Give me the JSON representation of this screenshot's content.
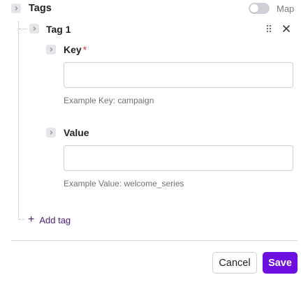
{
  "tags_section": {
    "title": "Tags",
    "toggle_label": "Map",
    "toggle_on": false
  },
  "tag_item": {
    "title": "Tag 1"
  },
  "key_field": {
    "label": "Key",
    "required_mark": "*",
    "value": "",
    "placeholder": "",
    "helper": "Example Key: campaign"
  },
  "value_field": {
    "label": "Value",
    "value": "",
    "placeholder": "",
    "helper": "Example Value: welcome_series"
  },
  "add_tag": {
    "plus": "+",
    "label": "Add tag"
  },
  "footer": {
    "cancel_label": "Cancel",
    "save_label": "Save"
  },
  "colors": {
    "accent": "#6d0fe0",
    "link": "#4a2275",
    "required": "#e0323b"
  },
  "icons": [
    "chevron-right-icon",
    "drag-handle-icon",
    "close-icon",
    "plus-icon"
  ]
}
